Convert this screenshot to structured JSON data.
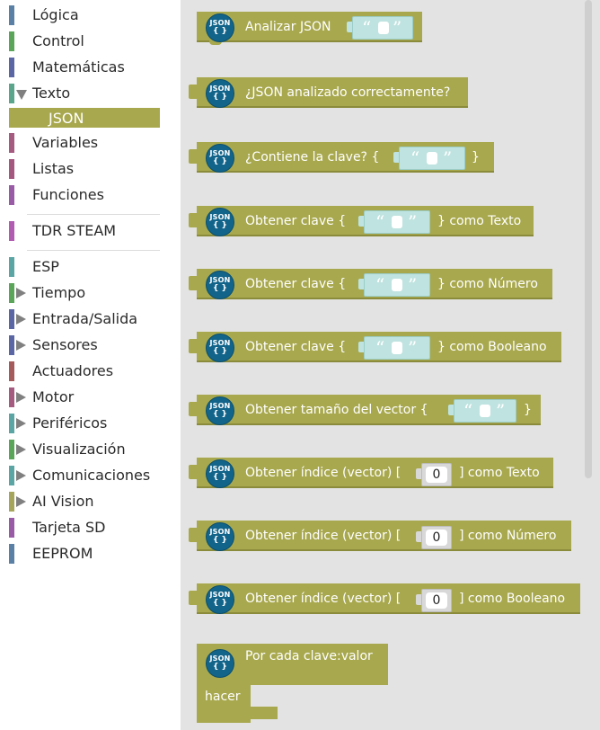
{
  "sidebar": {
    "categories": [
      {
        "label": "Lógica",
        "color": "#5b80a5"
      },
      {
        "label": "Control",
        "color": "#5ba55b"
      },
      {
        "label": "Matemáticas",
        "color": "#5b67a5"
      },
      {
        "label": "Texto",
        "color": "#5ba58c",
        "expanded": true
      },
      {
        "label": "Variables",
        "color": "#a55b80"
      },
      {
        "label": "Listas",
        "color": "#a5587f"
      },
      {
        "label": "Funciones",
        "color": "#995ba5"
      },
      {
        "label": "TDR STEAM",
        "color": "#b15bb1"
      },
      {
        "label": "ESP",
        "color": "#5ba5a5"
      },
      {
        "label": "Tiempo",
        "color": "#5ba55b"
      },
      {
        "label": "Entrada/Salida",
        "color": "#5b67a5"
      },
      {
        "label": "Sensores",
        "color": "#5b67a5"
      },
      {
        "label": "Actuadores",
        "color": "#a55b5b"
      },
      {
        "label": "Motor",
        "color": "#a55b80"
      },
      {
        "label": "Periféricos",
        "color": "#5ba5a5"
      },
      {
        "label": "Visualización",
        "color": "#5ba55b"
      },
      {
        "label": "Comunicaciones",
        "color": "#5ba5a5"
      },
      {
        "label": "AI Vision",
        "color": "#a5a55b"
      },
      {
        "label": "Tarjeta SD",
        "color": "#995ba5"
      },
      {
        "label": "EEPROM",
        "color": "#5b80a5"
      }
    ],
    "selected_subcategory": "JSON"
  },
  "flyout": {
    "icon_text_top": "JSON",
    "icon_text_bottom": "{ }",
    "quote_open": "“",
    "quote_close": "”",
    "blocks": [
      {
        "text1": "Analizar JSON"
      },
      {
        "text1": "¿JSON analizado correctamente?"
      },
      {
        "text1": "¿Contiene la clave? {",
        "text2": "}"
      },
      {
        "text1": "Obtener clave {",
        "text2": "} como Texto"
      },
      {
        "text1": "Obtener clave {",
        "text2": "} como Número"
      },
      {
        "text1": "Obtener clave {",
        "text2": "} como Booleano"
      },
      {
        "text1": "Obtener tamaño del vector {",
        "text2": "}"
      },
      {
        "text1": "Obtener índice (vector) [",
        "num": "0",
        "text2": "] como Texto"
      },
      {
        "text1": "Obtener índice (vector) [",
        "num": "0",
        "text2": "] como Número"
      },
      {
        "text1": "Obtener índice (vector) [",
        "num": "0",
        "text2": "] como Booleano"
      },
      {
        "text1": "Por cada clave:valor",
        "text2": "hacer"
      }
    ]
  },
  "colors": {
    "block": "#a8a84e",
    "icon": "#12648a",
    "string_slot": "#bfe3e0"
  }
}
